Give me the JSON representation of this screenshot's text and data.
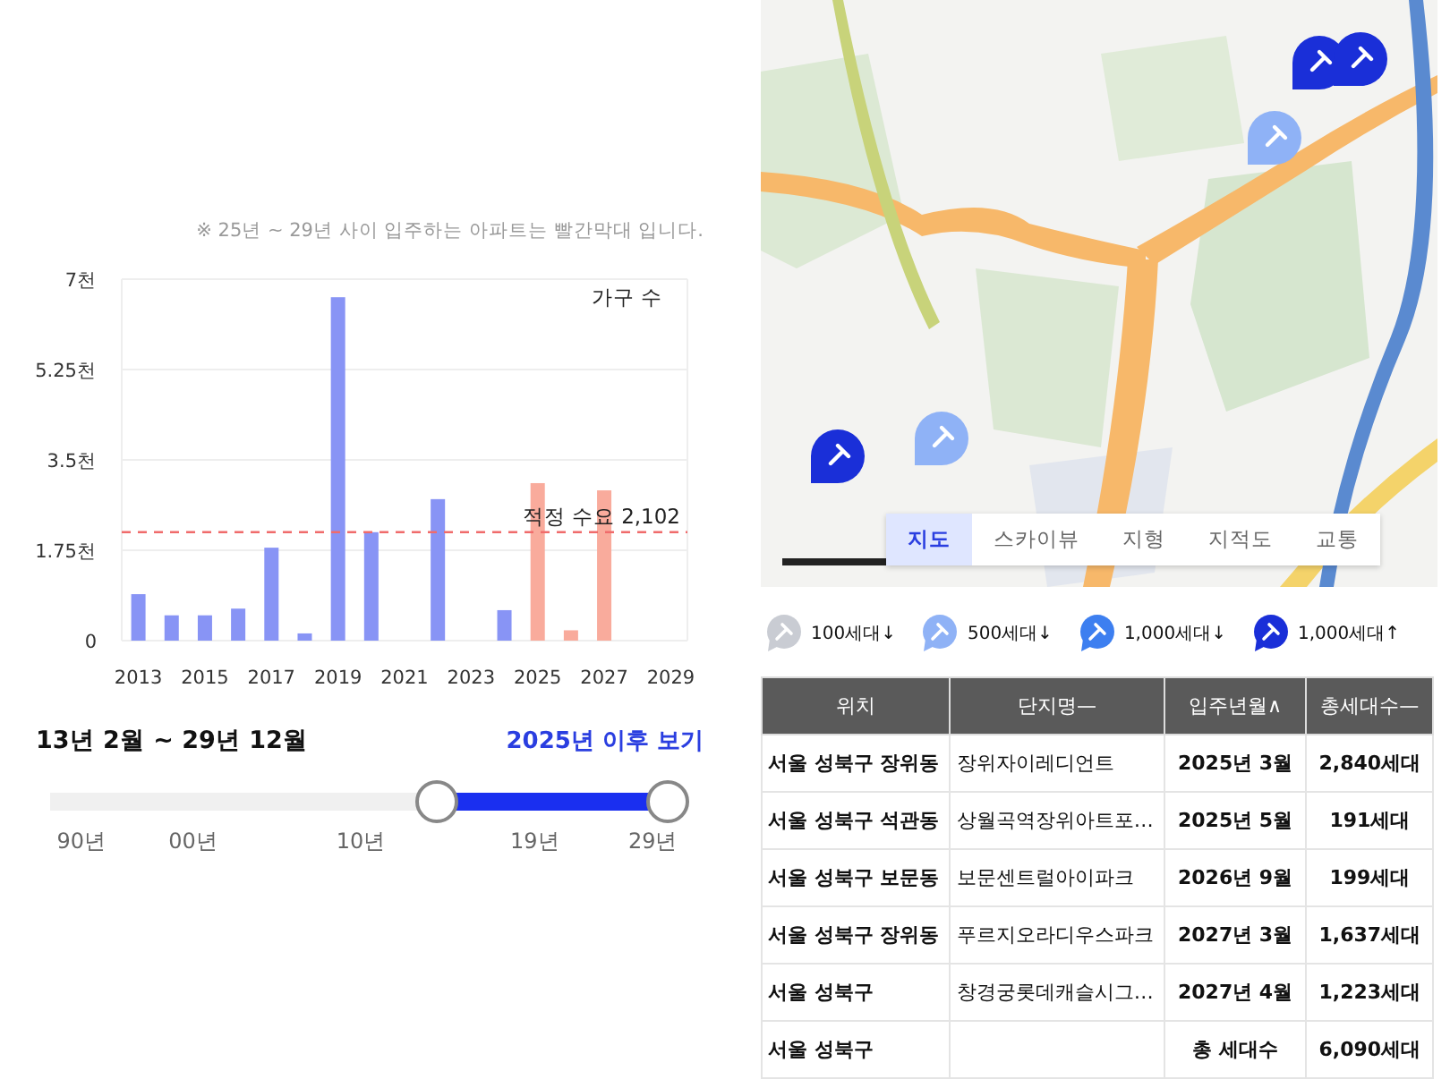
{
  "chart_note": "※ 25년 ~ 29년 사이 입주하는 아파트는 빨간막대 입니다.",
  "chart": {
    "chart_data": {
      "type": "bar",
      "ylabel": "가구 수",
      "categories": [
        "2013",
        null,
        "2015",
        null,
        "2017",
        null,
        "2019",
        null,
        "2021",
        null,
        "2023",
        null,
        "2025",
        null,
        "2027",
        null,
        "2029"
      ],
      "series": [
        {
          "color": "#8894f5",
          "values": [
            0.9,
            0.49,
            0.49,
            0.62,
            1.8,
            0.14,
            6.65,
            2.1,
            0,
            2.74,
            0,
            0.59,
            null,
            null,
            null,
            null,
            null
          ]
        },
        {
          "color": "#f9ab9c",
          "values": [
            null,
            null,
            null,
            null,
            null,
            null,
            null,
            null,
            null,
            null,
            null,
            null,
            3.05,
            0.2,
            2.91,
            0,
            0
          ]
        }
      ],
      "ylim": [
        0,
        7
      ],
      "yticks": [
        {
          "value": 0,
          "label": "0"
        },
        {
          "value": 1.75,
          "label": "1.75천"
        },
        {
          "value": 3.5,
          "label": "3.5천"
        },
        {
          "value": 5.25,
          "label": "5.25천"
        },
        {
          "value": 7,
          "label": "7천"
        }
      ],
      "grid": true,
      "ref_lines": [
        {
          "axis": "y",
          "value": 2.102,
          "label": "적정 수요 2,102"
        }
      ]
    }
  },
  "range": {
    "title": "13년 2월 ~ 29년 12월",
    "link": "2025년 이후 보기",
    "ticks": [
      "90년",
      "00년",
      "10년",
      "19년",
      "29년"
    ]
  },
  "map": {
    "markers": [
      {
        "color": "#1a2fd8"
      },
      {
        "color": "#1a2fd8"
      },
      {
        "color": "#8fb2f6"
      },
      {
        "color": "#1a2fd8"
      },
      {
        "color": "#8fb2f6"
      }
    ],
    "tabs": [
      {
        "label": "지도",
        "selected": true
      },
      {
        "label": "스카이뷰",
        "selected": false
      },
      {
        "label": "지형",
        "selected": false
      },
      {
        "label": "지적도",
        "selected": false
      },
      {
        "label": "교통",
        "selected": false
      }
    ]
  },
  "legend": [
    {
      "label": "100세대↓",
      "color": "#c9ccd3"
    },
    {
      "label": "500세대↓",
      "color": "#8fb2f6"
    },
    {
      "label": "1,000세대↓",
      "color": "#3d7ff0"
    },
    {
      "label": "1,000세대↑",
      "color": "#1a2fd8"
    }
  ],
  "table": {
    "columns": [
      {
        "label": "위치"
      },
      {
        "label": "단지명",
        "sort": "—"
      },
      {
        "label": "입주년월",
        "sort": "∧"
      },
      {
        "label": "총세대수",
        "sort": "—"
      }
    ],
    "rows": [
      [
        "서울 성북구 장위동",
        "장위자이레디언트",
        "2025년 3월",
        "2,840세대"
      ],
      [
        "서울 성북구 석관동",
        "상월곡역장위아트포…",
        "2025년 5월",
        "191세대"
      ],
      [
        "서울 성북구 보문동",
        "보문센트럴아이파크",
        "2026년 9월",
        "199세대"
      ],
      [
        "서울 성북구 장위동",
        "푸르지오라디우스파크",
        "2027년 3월",
        "1,637세대"
      ],
      [
        "서울 성북구",
        "창경궁롯데캐슬시그…",
        "2027년 4월",
        "1,223세대"
      ],
      [
        "서울 성북구",
        "",
        "총 세대수",
        "6,090세대"
      ]
    ]
  }
}
